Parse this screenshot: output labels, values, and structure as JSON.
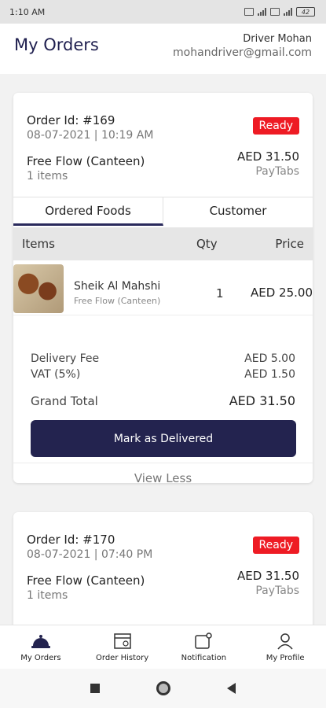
{
  "status_bar": {
    "time": "1:10 AM",
    "battery": "42"
  },
  "header": {
    "title": "My Orders",
    "driver_name": "Driver Mohan",
    "driver_email": "mohandriver@gmail.com"
  },
  "orders": [
    {
      "order_id": "Order Id: #169",
      "datetime": "08-07-2021 | 10:19 AM",
      "status": "Ready",
      "source": "Free Flow (Canteen)",
      "items_count": "1 items",
      "amount": "AED 31.50",
      "payment": "PayTabs",
      "tabs": [
        "Ordered Foods",
        "Customer"
      ],
      "table_headers": {
        "items": "Items",
        "qty": "Qty",
        "price": "Price"
      },
      "foods": [
        {
          "name": "Sheik Al Mahshi",
          "source": "Free Flow (Canteen)",
          "qty": "1",
          "price": "AED 25.00",
          "image_icon": "food-photo"
        }
      ],
      "delivery_fee_label": "Delivery Fee",
      "delivery_fee": "AED 5.00",
      "vat_label": "VAT (5%)",
      "vat": "AED 1.50",
      "grand_total_label": "Grand Total",
      "grand_total": "AED 31.50",
      "action_label": "Mark as Delivered",
      "toggle_label": "View Less"
    },
    {
      "order_id": "Order Id: #170",
      "datetime": "08-07-2021 | 07:40 PM",
      "status": "Ready",
      "source": "Free Flow (Canteen)",
      "items_count": "1 items",
      "amount": "AED 31.50",
      "payment": "PayTabs"
    }
  ],
  "bottom_nav": [
    {
      "label": "My Orders",
      "icon": "cloche-icon"
    },
    {
      "label": "Order History",
      "icon": "calendar-icon"
    },
    {
      "label": "Notification",
      "icon": "notification-icon"
    },
    {
      "label": "My Profile",
      "icon": "profile-icon"
    }
  ],
  "colors": {
    "primary": "#23234f",
    "ready": "#ee1b24",
    "background": "#f2f2f2"
  }
}
